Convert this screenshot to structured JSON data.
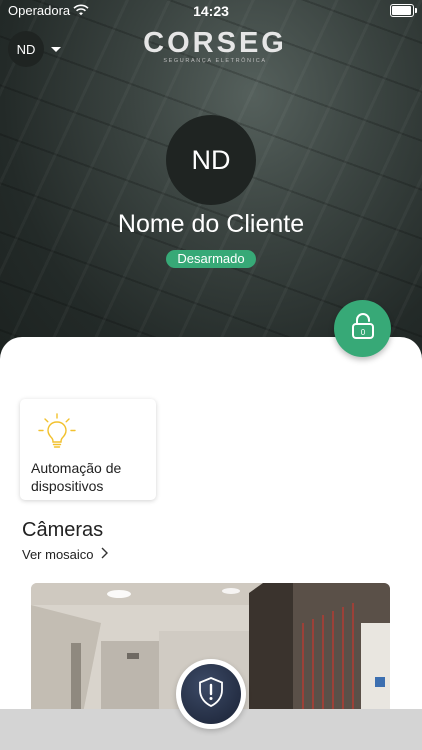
{
  "status_bar": {
    "carrier": "Operadora",
    "time": "14:23",
    "battery_level": 0.95
  },
  "header": {
    "avatar_initials": "ND",
    "brand_name": "CORSEG",
    "brand_tagline": "SEGURANÇA ELETRÔNICA"
  },
  "profile": {
    "initials": "ND",
    "client_name": "Nome do Cliente",
    "status": "Desarmado",
    "status_color": "#37a977"
  },
  "shortcuts": [
    {
      "label": "Automação de dispositivos",
      "icon": "lightbulb-icon",
      "icon_color": "#f2c12e"
    }
  ],
  "cameras": {
    "title": "Câmeras",
    "mosaic_link": "Ver mosaico"
  },
  "icons": {
    "lock_button": "unlocked-padlock-icon",
    "panic_button": "shield-alert-icon"
  },
  "colors": {
    "accent": "#37a977",
    "panic": "#1f2a40"
  }
}
